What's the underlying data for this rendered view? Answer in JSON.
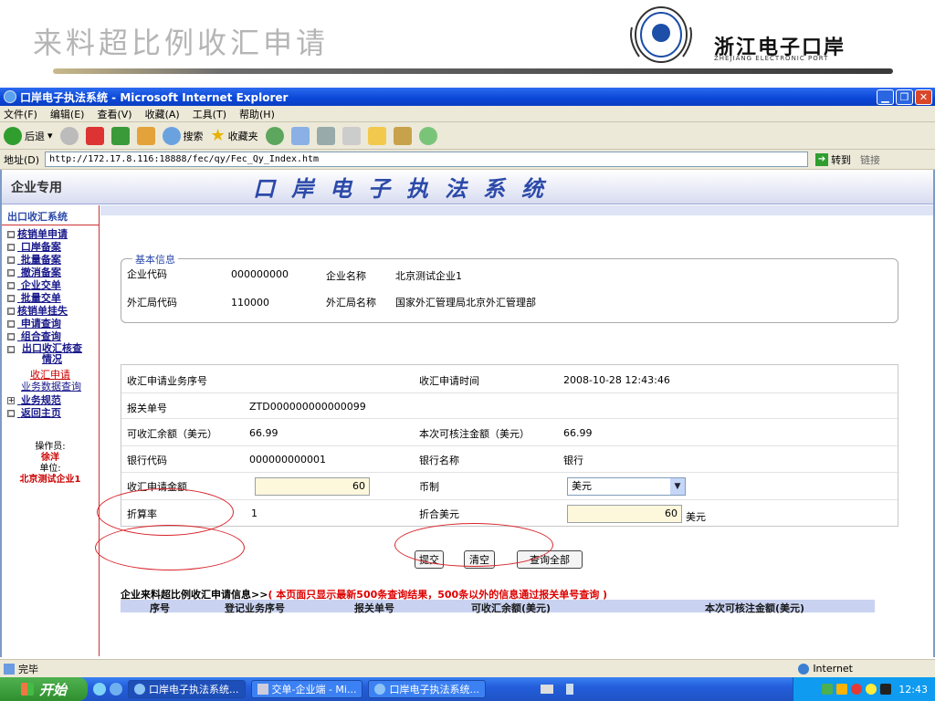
{
  "slide": {
    "title": "来料超比例收汇申请",
    "logo_text": "浙江电子口岸",
    "logo_sub": "ZHEJIANG ELECTRONIC PORT"
  },
  "window": {
    "title": "口岸电子执法系统 - Microsoft Internet Explorer",
    "menu": [
      "文件(F)",
      "编辑(E)",
      "查看(V)",
      "收藏(A)",
      "工具(T)",
      "帮助(H)"
    ],
    "toolbar": {
      "back": "后退",
      "search": "搜索",
      "favorites": "收藏夹"
    },
    "address_label": "地址(D)",
    "url": "http://172.17.8.116:18888/fec/qy/Fec_Qy_Index.htm",
    "go_label": "转到",
    "links_label": "链接"
  },
  "banner": {
    "corp": "企业专用",
    "system": "口岸电子执法系统"
  },
  "sidebar": {
    "header": "出口收汇系统",
    "items": [
      {
        "label": "核销单申请",
        "sq": "□"
      },
      {
        "label": "口岸备案",
        "sq": "□"
      },
      {
        "label": "批量备案",
        "sq": "□"
      },
      {
        "label": "撤消备案",
        "sq": "□"
      },
      {
        "label": "企业交单",
        "sq": "□"
      },
      {
        "label": "批量交单",
        "sq": "□"
      },
      {
        "label": "核销单挂失",
        "sq": "□"
      },
      {
        "label": "申请查询",
        "sq": "□"
      },
      {
        "label": "组合查询",
        "sq": "□"
      }
    ],
    "group_label": "出口收汇核查情况",
    "sub_active": "收汇申请",
    "sub_next": "业务数据查询",
    "more_items": [
      {
        "label": "业务规范",
        "sq": "+"
      },
      {
        "label": "返回主页",
        "sq": "□"
      }
    ],
    "operator_label": "操作员:",
    "operator": "徐洋",
    "unit_label": "单位:",
    "unit": "北京测试企业1"
  },
  "basic": {
    "legend": "基本信息",
    "corp_code_label": "企业代码",
    "corp_code": "000000000",
    "corp_name_label": "企业名称",
    "corp_name": "北京测试企业1",
    "fx_code_label": "外汇局代码",
    "fx_code": "110000",
    "fx_name_label": "外汇局名称",
    "fx_name": "国家外汇管理局北京外汇管理部"
  },
  "form": {
    "seq_label": "收汇申请业务序号",
    "seq": "",
    "time_label": "收汇申请时间",
    "time": "2008-10-28 12:43:46",
    "decl_label": "报关单号",
    "decl": "ZTD000000000000099",
    "balance_label": "可收汇余额（美元）",
    "balance": "66.99",
    "verify_label": "本次可核注金额（美元）",
    "verify": "66.99",
    "bank_code_label": "银行代码",
    "bank_code": "000000000001",
    "bank_name_label": "银行名称",
    "bank_name": "银行",
    "amount_label": "收汇申请金额",
    "amount": "60",
    "currency_label": "币制",
    "currency": "美元",
    "rate_label": "折算率",
    "rate": "1",
    "usd_label": "折合美元",
    "usd": "60",
    "usd_unit": "美元"
  },
  "buttons": {
    "submit": "提交",
    "clear": "清空",
    "query_all": "查询全部"
  },
  "list": {
    "title": "企业来料超比例收汇申请信息>>",
    "note": "( 本页面只显示最新500条查询结果，500条以外的信息通过报关单号查询 )",
    "columns": [
      "序号",
      "登记业务序号",
      "报关单号",
      "可收汇余额(美元)",
      "本次可核注金额(美元)"
    ]
  },
  "status": {
    "done": "完毕",
    "zone": "Internet"
  },
  "taskbar": {
    "start": "开始",
    "tasks": [
      "口岸电子执法系统...",
      "交单-企业端 - Mi...",
      "口岸电子执法系统..."
    ],
    "clock": "12:43"
  },
  "colors": {
    "annotation": "#d8232a",
    "link": "#1a1a8c",
    "banner_text": "#2c4aa8"
  }
}
